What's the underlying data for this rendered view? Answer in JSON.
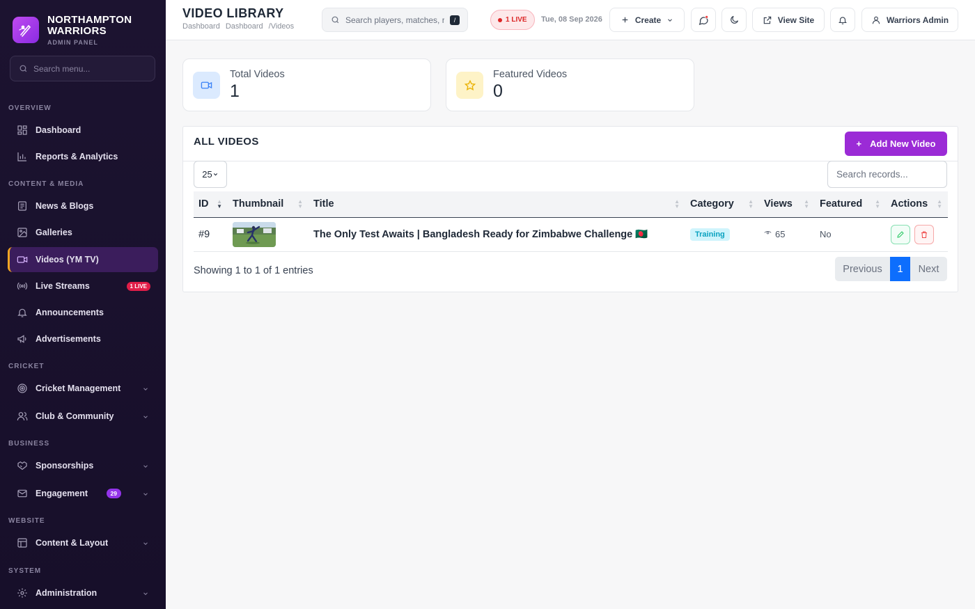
{
  "brand": {
    "name_line1": "NORTHAMPTON",
    "name_line2": "WARRIORS",
    "subtitle": "ADMIN PANEL"
  },
  "sidebar": {
    "search_placeholder": "Search menu...",
    "sections": {
      "overview": "OVERVIEW",
      "content": "CONTENT & MEDIA",
      "cricket": "CRICKET",
      "business": "BUSINESS",
      "website": "WEBSITE",
      "system": "SYSTEM"
    },
    "items": {
      "dashboard": "Dashboard",
      "reports": "Reports & Analytics",
      "news": "News & Blogs",
      "galleries": "Galleries",
      "videos": "Videos (YM TV)",
      "live": "Live Streams",
      "live_badge": "1 LIVE",
      "announcements": "Announcements",
      "ads": "Advertisements",
      "cricket_mgmt": "Cricket Management",
      "club": "Club & Community",
      "sponsorships": "Sponsorships",
      "engagement": "Engagement",
      "engagement_badge": "29",
      "content_layout": "Content & Layout",
      "administration": "Administration"
    },
    "active_item": "videos"
  },
  "header": {
    "title": "VIDEO LIBRARY",
    "breadcrumbs": [
      "Dashboard",
      "Dashboard",
      "/Videos"
    ],
    "search_placeholder": "Search players, matches, r",
    "search_shortcut": "/",
    "live_label": "1 LIVE",
    "date": "Tue, 08 Sep 2026",
    "create_label": "Create",
    "view_site_label": "View Site",
    "user_label": "Warriors Admin"
  },
  "stats": [
    {
      "label": "Total Videos",
      "value": "1",
      "icon": "video-icon",
      "color": "#3b82f6"
    },
    {
      "label": "Featured Videos",
      "value": "0",
      "icon": "star-icon",
      "color": "#eab308"
    }
  ],
  "panel": {
    "title": "ALL VIDEOS",
    "add_label": "Add New Video",
    "page_length": "25",
    "search_placeholder": "Search records...",
    "columns": [
      "ID",
      "Thumbnail",
      "Title",
      "Category",
      "Views",
      "Featured",
      "Actions"
    ],
    "rows": [
      {
        "id": "#9",
        "title": "The Only Test Awaits | Bangladesh Ready for Zimbabwe Challenge 🇧🇩",
        "category": "Training",
        "views": "65",
        "featured": "No"
      }
    ],
    "info": "Showing 1 to 1 of 1 entries",
    "pagination": {
      "prev": "Previous",
      "current": "1",
      "next": "Next"
    }
  },
  "colors": {
    "accent": "#9b2bd6",
    "sidebar_bg": "#1c1330",
    "active_border": "#f5a623",
    "live_red": "#dc2626",
    "pager_blue": "#0d6efd"
  }
}
